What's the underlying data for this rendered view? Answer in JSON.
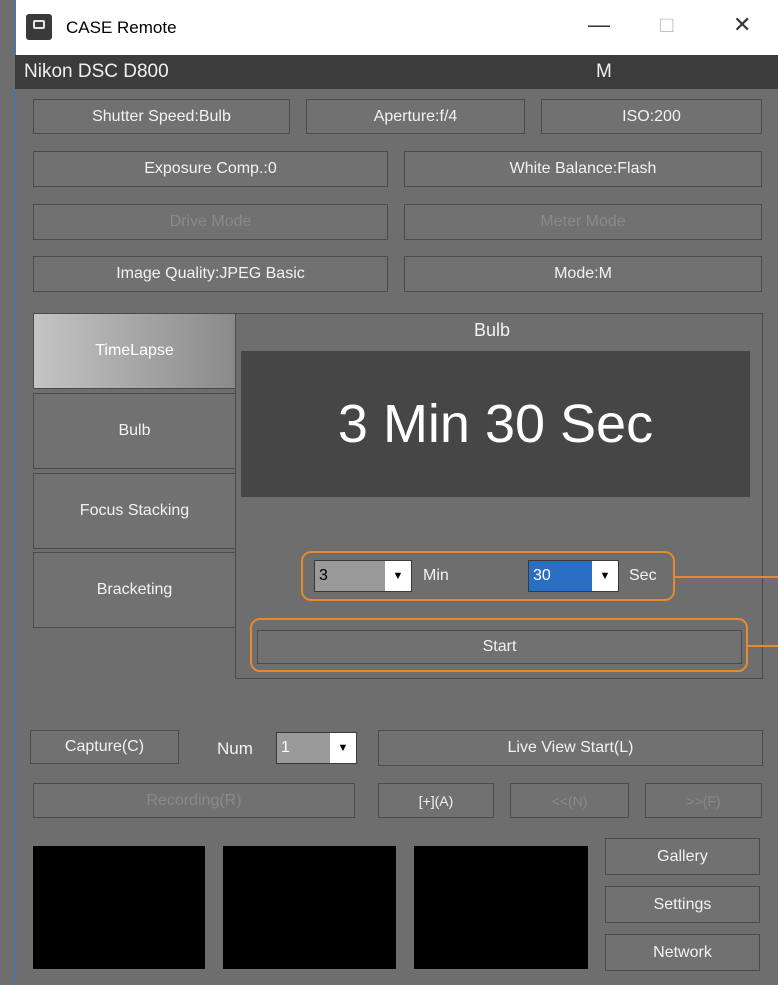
{
  "window": {
    "title": "CASE Remote",
    "minimize": "—",
    "maximize": "□",
    "close": "✕"
  },
  "header": {
    "camera": "Nikon DSC D800",
    "mode": "M"
  },
  "settings": {
    "shutter": "Shutter Speed:Bulb",
    "aperture": "Aperture:f/4",
    "iso": "ISO:200",
    "exposure": "Exposure Comp.:0",
    "white_balance": "White Balance:Flash",
    "drive": "Drive Mode",
    "meter": "Meter Mode",
    "quality": "Image Quality:JPEG Basic",
    "mode": "Mode:M"
  },
  "tabs": [
    "TimeLapse",
    "Bulb",
    "Focus Stacking",
    "Bracketing"
  ],
  "bulb": {
    "title": "Bulb",
    "display": "3 Min 30 Sec",
    "min_value": "3",
    "min_label": "Min",
    "sec_value": "30",
    "sec_label": "Sec",
    "start": "Start"
  },
  "controls": {
    "capture": "Capture(C)",
    "num_label": "Num",
    "num_value": "1",
    "live_view": "Live View Start(L)",
    "recording": "Recording(R)",
    "af": "[+](A)",
    "near": "<<(N)",
    "far": ">>(F)"
  },
  "side": {
    "gallery": "Gallery",
    "settings": "Settings",
    "network": "Network"
  }
}
